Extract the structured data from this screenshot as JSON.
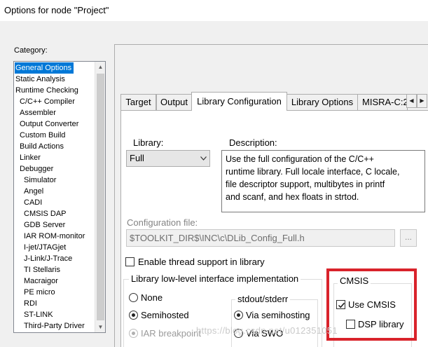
{
  "window": {
    "title": "Options for node \"Project\""
  },
  "category": {
    "label": "Category:",
    "items": [
      {
        "label": "General Options",
        "indent": 0,
        "selected": true
      },
      {
        "label": "Static Analysis",
        "indent": 0
      },
      {
        "label": "Runtime Checking",
        "indent": 0
      },
      {
        "label": "C/C++ Compiler",
        "indent": 1
      },
      {
        "label": "Assembler",
        "indent": 1
      },
      {
        "label": "Output Converter",
        "indent": 1
      },
      {
        "label": "Custom Build",
        "indent": 1
      },
      {
        "label": "Build Actions",
        "indent": 1
      },
      {
        "label": "Linker",
        "indent": 1
      },
      {
        "label": "Debugger",
        "indent": 1
      },
      {
        "label": "Simulator",
        "indent": 2
      },
      {
        "label": "Angel",
        "indent": 2
      },
      {
        "label": "CADI",
        "indent": 2
      },
      {
        "label": "CMSIS DAP",
        "indent": 2
      },
      {
        "label": "GDB Server",
        "indent": 2
      },
      {
        "label": "IAR ROM-monitor",
        "indent": 2
      },
      {
        "label": "I-jet/JTAGjet",
        "indent": 2
      },
      {
        "label": "J-Link/J-Trace",
        "indent": 2
      },
      {
        "label": "TI Stellaris",
        "indent": 2
      },
      {
        "label": "Macraigor",
        "indent": 2
      },
      {
        "label": "PE micro",
        "indent": 2
      },
      {
        "label": "RDI",
        "indent": 2
      },
      {
        "label": "ST-LINK",
        "indent": 2
      },
      {
        "label": "Third-Party Driver",
        "indent": 2
      }
    ]
  },
  "tabs": [
    {
      "label": "Target"
    },
    {
      "label": "Output"
    },
    {
      "label": "Library Configuration",
      "active": true
    },
    {
      "label": "Library Options"
    },
    {
      "label": "MISRA-C:2"
    }
  ],
  "library": {
    "label": "Library:",
    "selected": "Full"
  },
  "description": {
    "label": "Description:",
    "lines": [
      "Use the full configuration of the C/C++",
      "runtime library. Full locale interface, C locale,",
      "file descriptor support, multibytes in printf",
      "and scanf, and hex floats in strtod."
    ]
  },
  "config_file": {
    "label": "Configuration file:",
    "value": "$TOOLKIT_DIR$\\INC\\c\\DLib_Config_Full.h",
    "browse_label": "..."
  },
  "thread_support": {
    "label": "Enable thread support in library",
    "checked": false
  },
  "low_level": {
    "title": "Library low-level interface implementation",
    "options": [
      {
        "label": "None",
        "selected": false,
        "enabled": true
      },
      {
        "label": "Semihosted",
        "selected": true,
        "enabled": true
      },
      {
        "label": "IAR breakpoint",
        "selected": true,
        "enabled": false
      }
    ]
  },
  "stdout": {
    "title": "stdout/stderr",
    "options": [
      {
        "label": "Via semihosting",
        "selected": true
      },
      {
        "label": "Via SWO",
        "selected": false
      }
    ]
  },
  "cmsis": {
    "title": "CMSIS",
    "use_label": "Use CMSIS",
    "use_checked": true,
    "dsp_label": "DSP library",
    "dsp_checked": false
  },
  "watermark": "https://blog.csdn.net/u012351051",
  "colors": {
    "selection": "#0078d7",
    "highlight": "#d9232b"
  }
}
